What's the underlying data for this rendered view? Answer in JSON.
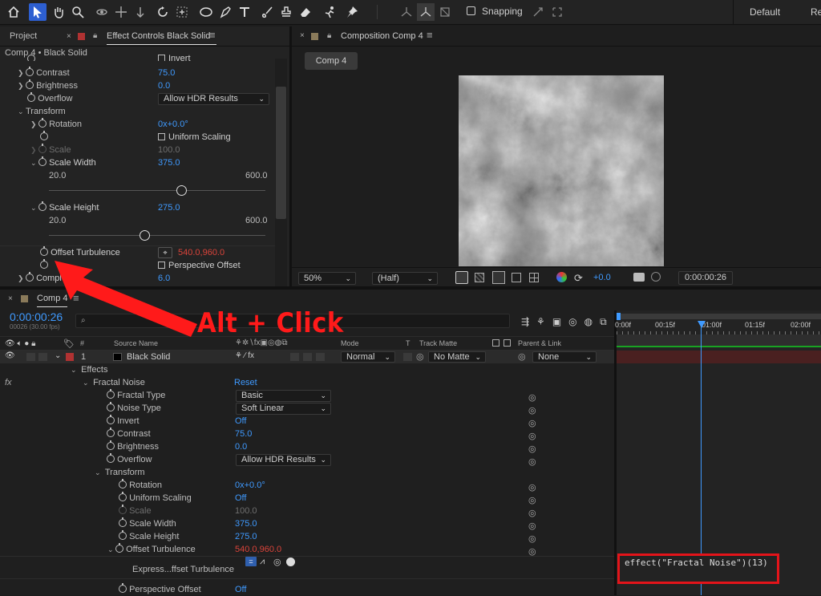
{
  "toolbar": {
    "snapping_label": "Snapping",
    "workspace_default": "Default",
    "workspace_next": "Re"
  },
  "effect_controls": {
    "project_tab": "Project",
    "tab_title": "Effect Controls Black Solid",
    "breadcrumb": "Comp 4 • Black Solid",
    "invent_label": "Invert",
    "contrast_label": "Contrast",
    "contrast_value": "75.0",
    "brightness_label": "Brightness",
    "brightness_value": "0.0",
    "overflow_label": "Overflow",
    "overflow_value": "Allow HDR Results",
    "transform_label": "Transform",
    "rotation_label": "Rotation",
    "rotation_value_a": "0x",
    "rotation_value_b": "+0.0°",
    "uniform_scaling_label": "Uniform Scaling",
    "scale_label": "Scale",
    "scale_value": "100.0",
    "scale_width_label": "Scale Width",
    "scale_width_value": "375.0",
    "scale_width_min": "20.0",
    "scale_width_max": "600.0",
    "scale_width_slider": 0.61,
    "scale_height_label": "Scale Height",
    "scale_height_value": "275.0",
    "scale_height_min": "20.0",
    "scale_height_max": "600.0",
    "scale_height_slider": 0.44,
    "offset_turbulence_label": "Offset Turbulence",
    "offset_turbulence_value": "540.0,960.0",
    "perspective_offset_label": "Perspective Offset",
    "complexity_label": "Complexity",
    "complexity_value": "6.0"
  },
  "composition": {
    "tab_title": "Composition Comp 4",
    "comp_button": "Comp 4",
    "zoom": "50%",
    "resolution": "(Half)",
    "exposure": "+0.0",
    "timecode": "0:00:00:26"
  },
  "annotation": {
    "text": "Alt + Click"
  },
  "timeline": {
    "tab_title": "Comp 4",
    "timecode": "0:00:00:26",
    "frames": "00026 (30.00 fps)",
    "search_placeholder": "",
    "columns": {
      "source_name": "Source Name",
      "mode": "Mode",
      "t": "T",
      "track_matte": "Track Matte",
      "parent_link": "Parent & Link",
      "num": "#"
    },
    "ruler": [
      "0:00f",
      "00:15f",
      "01:00f",
      "01:15f",
      "02:00f"
    ],
    "layer": {
      "index": "1",
      "name": "Black Solid",
      "mode": "Normal",
      "matte": "No Matte",
      "parent": "None"
    },
    "rows": {
      "effects": "Effects",
      "fractal_noise": "Fractal Noise",
      "reset": "Reset",
      "fractal_type": "Fractal Type",
      "fractal_type_value": "Basic",
      "noise_type": "Noise Type",
      "noise_type_value": "Soft Linear",
      "invert": "Invert",
      "invert_value": "Off",
      "contrast": "Contrast",
      "contrast_value": "75.0",
      "brightness": "Brightness",
      "brightness_value": "0.0",
      "overflow": "Overflow",
      "overflow_value": "Allow HDR Results",
      "transform": "Transform",
      "rotation": "Rotation",
      "rotation_value_a": "0x",
      "rotation_value_b": "+0.0°",
      "uniform_scaling": "Uniform Scaling",
      "uniform_scaling_value": "Off",
      "scale": "Scale",
      "scale_value": "100.0",
      "scale_width": "Scale Width",
      "scale_width_value": "375.0",
      "scale_height": "Scale Height",
      "scale_height_value": "275.0",
      "offset_turbulence": "Offset Turbulence",
      "offset_turbulence_value": "540.0,960.0",
      "expression_label": "Express...ffset Turbulence",
      "perspective_offset": "Perspective Offset",
      "perspective_offset_value": "Off"
    },
    "expression_code": "effect(\"Fractal Noise\")(13)"
  },
  "colors": {
    "accent_blue": "#3f9aff",
    "keyframe_red": "#d9433a",
    "annotation_red": "#ff1a1a",
    "layer_label_red": "#b03232",
    "timeline_bar": "#4a2020"
  }
}
